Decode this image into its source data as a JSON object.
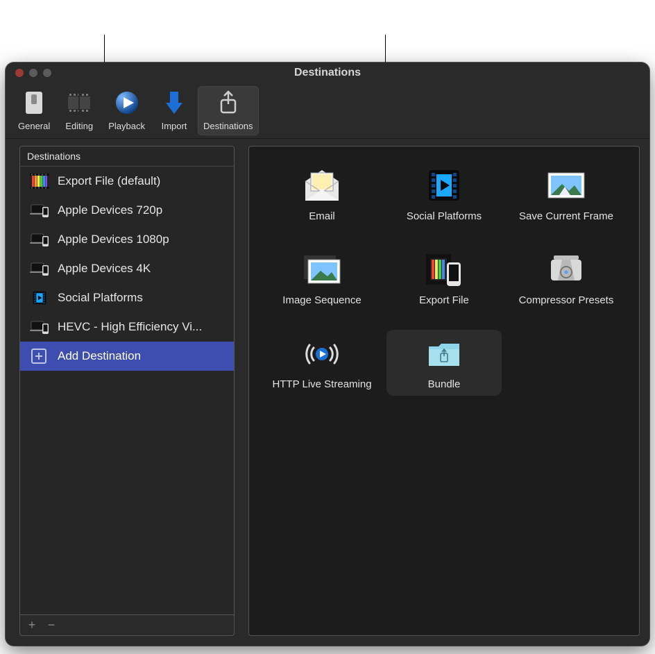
{
  "window": {
    "title": "Destinations"
  },
  "toolbar": {
    "items": [
      {
        "name": "general",
        "label": "General",
        "icon": "slider-icon",
        "selected": false
      },
      {
        "name": "editing",
        "label": "Editing",
        "icon": "filmstrip-icon",
        "selected": false
      },
      {
        "name": "playback",
        "label": "Playback",
        "icon": "play-circle-icon",
        "selected": false
      },
      {
        "name": "import",
        "label": "Import",
        "icon": "download-arrow-icon",
        "selected": false
      },
      {
        "name": "destinations",
        "label": "Destinations",
        "icon": "share-up-icon",
        "selected": true
      }
    ]
  },
  "sidebar": {
    "header": "Destinations",
    "items": [
      {
        "name": "export-file",
        "label": "Export File (default)",
        "icon": "rainbow-filmstrip-icon"
      },
      {
        "name": "apple-720p",
        "label": "Apple Devices 720p",
        "icon": "devices-icon"
      },
      {
        "name": "apple-1080p",
        "label": "Apple Devices 1080p",
        "icon": "devices-icon"
      },
      {
        "name": "apple-4k",
        "label": "Apple Devices 4K",
        "icon": "devices-icon"
      },
      {
        "name": "social",
        "label": "Social Platforms",
        "icon": "play-filmstrip-blue-icon"
      },
      {
        "name": "hevc",
        "label": "HEVC - High Efficiency Vi...",
        "icon": "devices-icon"
      },
      {
        "name": "add-destination",
        "label": "Add Destination",
        "icon": "plus-box-icon",
        "selected": true
      }
    ],
    "footer": {
      "add_label": "+",
      "remove_label": "−"
    }
  },
  "grid": {
    "items": [
      {
        "name": "email",
        "label": "Email",
        "icon": "envelope-photo-icon"
      },
      {
        "name": "social-platforms",
        "label": "Social Platforms",
        "icon": "play-filmstrip-blue-icon"
      },
      {
        "name": "save-frame",
        "label": "Save Current Frame",
        "icon": "landscape-photo-icon"
      },
      {
        "name": "image-sequence",
        "label": "Image Sequence",
        "icon": "photo-stack-icon"
      },
      {
        "name": "export-file",
        "label": "Export File",
        "icon": "film-phone-icon"
      },
      {
        "name": "compressor",
        "label": "Compressor Presets",
        "icon": "compressor-icon"
      },
      {
        "name": "hls",
        "label": "HTTP Live Streaming",
        "icon": "broadcast-icon"
      },
      {
        "name": "bundle",
        "label": "Bundle",
        "icon": "bundle-folder-icon",
        "highlight": true
      }
    ]
  }
}
